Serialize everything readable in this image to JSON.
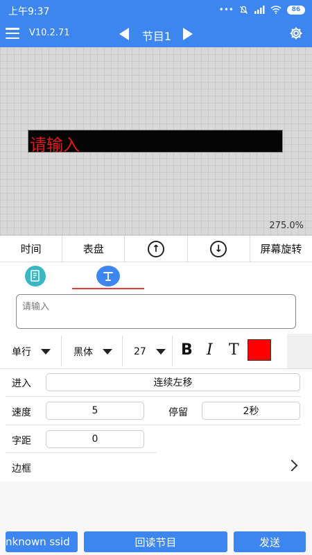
{
  "status_bar": {
    "time": "上午9:37",
    "battery": "86",
    "icons_text": "•••"
  },
  "app_bar": {
    "version": "V10.2.71",
    "program_title": "节目1",
    "menu_icon": "hamburger-icon",
    "settings_icon": "gear-icon"
  },
  "canvas": {
    "led_text": "请输入",
    "zoom": "275.0%",
    "led_color": "#e01818"
  },
  "toolbar": {
    "time_label": "时间",
    "dial_label": "表盘",
    "rotate_label": "屏幕旋转"
  },
  "editor": {
    "text_placeholder": "请输入",
    "line_mode": "单行",
    "font": "黑体",
    "font_size": "27",
    "bold_label": "B",
    "italic_label": "I",
    "text_label": "T",
    "text_color": "#ff0000",
    "enter_label": "进入",
    "enter_value": "连续左移",
    "speed_label": "速度",
    "speed_value": "5",
    "stay_label": "停留",
    "stay_value": "2秒",
    "spacing_label": "字距",
    "spacing_value": "0",
    "border_label": "边框"
  },
  "bottom": {
    "ssid_label": "nknown ssid",
    "read_label": "回读节目",
    "send_label": "发送"
  },
  "colors": {
    "primary": "#3d86f0",
    "accent_tab": "#3bb7c4",
    "tab_underline": "#e04040"
  }
}
